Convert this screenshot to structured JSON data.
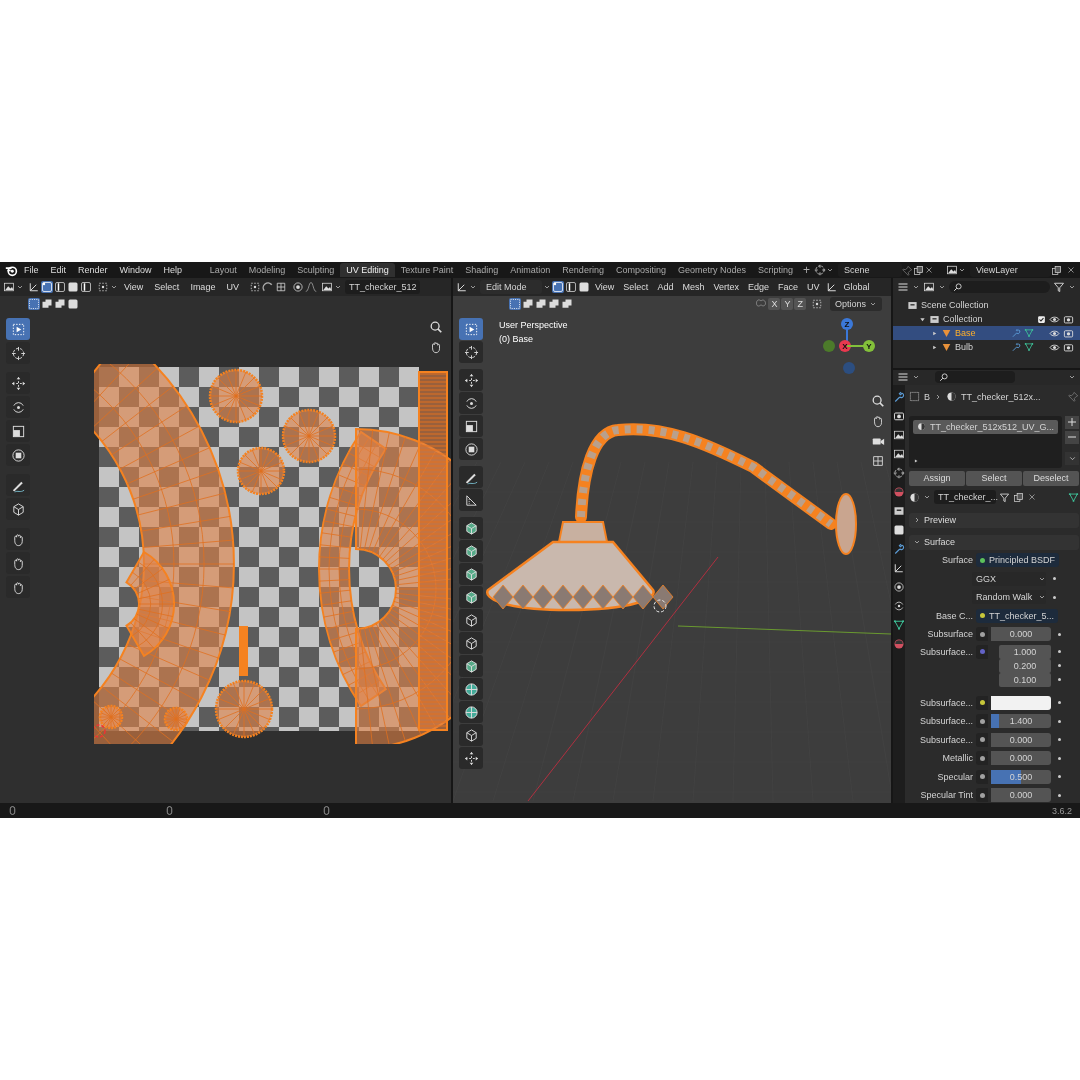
{
  "top_bar": {
    "menus": [
      "File",
      "Edit",
      "Render",
      "Window",
      "Help"
    ],
    "workspaces": [
      {
        "label": "Layout",
        "selected": false
      },
      {
        "label": "Modeling",
        "selected": false
      },
      {
        "label": "Sculpting",
        "selected": false
      },
      {
        "label": "UV Editing",
        "selected": true
      },
      {
        "label": "Texture Paint",
        "selected": false
      },
      {
        "label": "Shading",
        "selected": false
      },
      {
        "label": "Animation",
        "selected": false
      },
      {
        "label": "Rendering",
        "selected": false
      },
      {
        "label": "Compositing",
        "selected": false
      },
      {
        "label": "Geometry Nodes",
        "selected": false
      },
      {
        "label": "Scripting",
        "selected": false
      }
    ],
    "add_workspace": "+",
    "scene": "Scene",
    "view_layer": "ViewLayer"
  },
  "uv_editor": {
    "menus": [
      "View",
      "Select",
      "Image",
      "UV"
    ],
    "image_name": "TT_checker_512"
  },
  "viewport": {
    "mode": "Edit Mode",
    "menus": [
      "View",
      "Select",
      "Add",
      "Mesh",
      "Vertex",
      "Edge",
      "Face",
      "UV"
    ],
    "orientation": "Global",
    "mirror_axes": [
      "X",
      "Y",
      "Z"
    ],
    "options": "Options",
    "view_name": "User Perspective",
    "object_label": "(0) Base",
    "gizmo_axes": [
      {
        "label": "Z",
        "color": "#3b78d8"
      },
      {
        "label": "X",
        "color": "#e8384f"
      },
      {
        "label": "Y",
        "color": "#83c03a"
      }
    ]
  },
  "outliner": {
    "items": [
      {
        "name": "Scene Collection",
        "children": [
          {
            "name": "Collection",
            "checked": true,
            "children": [
              {
                "name": "Base",
                "selected": true
              },
              {
                "name": "Bulb",
                "selected": false
              }
            ]
          }
        ]
      }
    ]
  },
  "properties": {
    "object": "B",
    "material": "TT_checker_512x...",
    "slots": [
      {
        "name": "TT_checker_512x512_UV_G...",
        "selected": true
      }
    ],
    "slot_buttons": [
      "Assign",
      "Select",
      "Deselect"
    ],
    "material_name": "TT_checker_...",
    "panels": [
      {
        "title": "Preview",
        "expanded": false
      },
      {
        "title": "Surface",
        "expanded": true
      }
    ],
    "fields": [
      {
        "kind": "link",
        "label": "Surface",
        "value": "Principled BSDF",
        "color": "#5cc15c"
      },
      {
        "kind": "dropdown",
        "value": "GGX"
      },
      {
        "kind": "dropdown",
        "value": "Random Walk"
      },
      {
        "kind": "link",
        "label": "Base C...",
        "value": "TT_checker_5...",
        "color": "#c7c73a"
      },
      {
        "kind": "slider",
        "label": "Subsurface",
        "value": "0.000",
        "color": "#a1a1a1"
      },
      {
        "kind": "vector",
        "label": "Subsurface...",
        "values": [
          "1.000",
          "0.200",
          "0.100"
        ],
        "color": "#6363c7"
      },
      {
        "kind": "swatch",
        "label": "Subsurface...",
        "color": "#c7c73a",
        "swatch": {
          "color": "#f2f2f2"
        }
      },
      {
        "kind": "slider",
        "label": "Subsurface...",
        "value": "1.400",
        "level": 0.14,
        "color": "#a1a1a1"
      },
      {
        "kind": "slider",
        "label": "Subsurface...",
        "value": "0.000",
        "color": "#a1a1a1"
      },
      {
        "kind": "slider",
        "label": "Metallic",
        "value": "0.000",
        "color": "#a1a1a1"
      },
      {
        "kind": "slider",
        "label": "Specular",
        "value": "0.500",
        "level": 0.5,
        "color": "#a1a1a1"
      },
      {
        "kind": "slider",
        "label": "Specular Tint",
        "value": "0.000",
        "color": "#a1a1a1"
      }
    ]
  },
  "status_bar": {
    "version": "3.6.2"
  }
}
